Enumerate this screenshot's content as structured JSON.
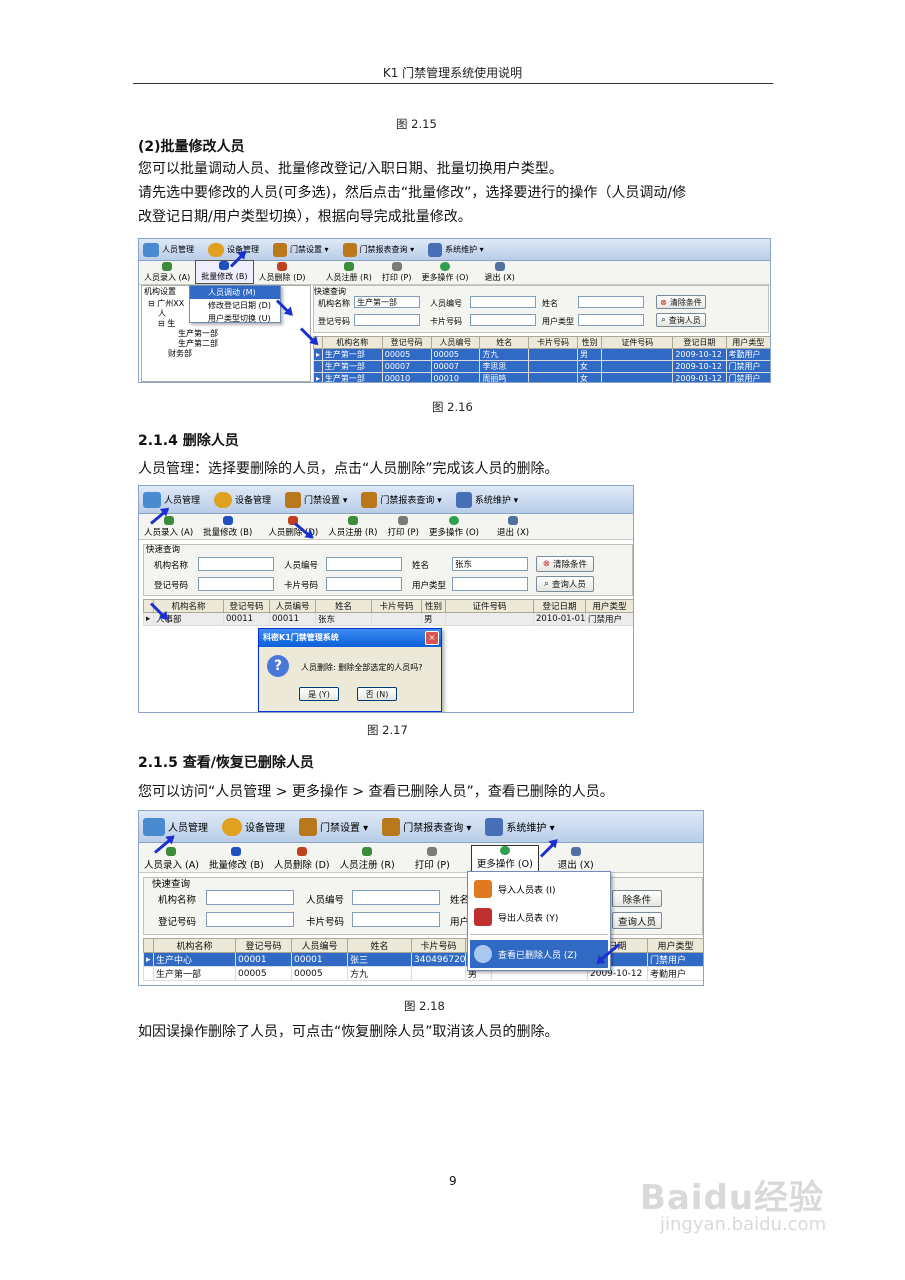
{
  "header": {
    "title": "K1 门禁管理系统使用说明"
  },
  "fig215": {
    "caption": "图 2.15"
  },
  "sec_batch": {
    "title": "(2)批量修改人员",
    "p1": "您可以批量调动人员、批量修改登记/入职日期、批量切换用户类型。",
    "p2a": "请先选中要修改的人员(可多选)，然后点击“批量修改”，选择要进行的操作（人员调动/修",
    "p2b": "改登记日期/用户类型切换），根据向导完成批量修改。"
  },
  "menu": {
    "people": "人员管理",
    "device": "设备管理",
    "door": "门禁设置 ▾",
    "report": "门禁报表查询 ▾",
    "system": "系统维护 ▾"
  },
  "toolbar": {
    "add": "人员录入 (A)",
    "batch": "批量修改 (B)",
    "delete": "人员删除 (D)",
    "cancel": "人员注册 (R)",
    "print": "打印 (P)",
    "more": "更多操作 (O)",
    "exit": "退出 (X)"
  },
  "quick": {
    "legend": "快速查询",
    "org": "机构名称",
    "empno": "人员编号",
    "name": "姓名",
    "regno": "登记号码",
    "cardno": "卡片号码",
    "usertype": "用户类型",
    "clear": "清除条件",
    "query": "查询人员"
  },
  "grid_headers": [
    "机构名称",
    "登记号码",
    "人员编号",
    "姓名",
    "卡片号码",
    "性别",
    "证件号码",
    "登记日期",
    "用户类型"
  ],
  "fig216": {
    "org_label": "机构设置",
    "org_value": "生产第一部",
    "tree": [
      "广州XX",
      "人",
      "生",
      "生产第一部",
      "生产第二部",
      "财务部"
    ],
    "menu_items": [
      "人员调动 (M)",
      "修改登记日期 (D)",
      "用户类型切换 (U)"
    ],
    "rows": [
      [
        "生产第一部",
        "00005",
        "00005",
        "方九",
        "",
        "男",
        "",
        "2009-10-12",
        "考勤用户"
      ],
      [
        "生产第一部",
        "00007",
        "00007",
        "李思思",
        "",
        "女",
        "",
        "2009-10-12",
        "门禁用户"
      ],
      [
        "生产第一部",
        "00010",
        "00010",
        "周丽鸣",
        "",
        "女",
        "",
        "2009-01-12",
        "门禁用户"
      ]
    ],
    "caption": "图 2.16"
  },
  "sec_delete": {
    "title": "2.1.4 删除人员",
    "p1": "人员管理：选择要删除的人员，点击“人员删除”完成该人员的删除。"
  },
  "fig217": {
    "name_value": "张东",
    "row": [
      "人事部",
      "00011",
      "00011",
      "张东",
      "",
      "男",
      "",
      "2010-01-01",
      "门禁用户"
    ],
    "dialog_title": "科密K1门禁管理系统",
    "dialog_msg": "人员删除: 删除全部选定的人员吗?",
    "yes": "是 (Y)",
    "no": "否 (N)",
    "caption": "图 2.17"
  },
  "sec_restore": {
    "title": "2.1.5 查看/恢复已删除人员",
    "p1": "您可以访问“人员管理 > 更多操作 > 查看已删除人员”，查看已删除的人员。",
    "p2": "如因误操作删除了人员，可点击“恢复删除人员”取消该人员的删除。"
  },
  "fig218": {
    "menu_items": [
      "导入人员表 (I)",
      "导出人员表 (Y)",
      "查看已删除人员 (Z)"
    ],
    "clear_partial": "除条件",
    "query_partial": "查询人员",
    "name_partial": "姓名",
    "usertype_partial": "用户",
    "header_partial": [
      "机构名称",
      "登记号码",
      "人员编号",
      "姓名",
      "卡片号码",
      "",
      "",
      "日期",
      "用户类型"
    ],
    "rows": [
      [
        "生产中心",
        "00001",
        "00001",
        "张三",
        "3404967200",
        "",
        "",
        "1-01",
        "门禁用户"
      ],
      [
        "生产第一部",
        "00005",
        "00005",
        "方九",
        "",
        "男",
        "",
        "2009-10-12",
        "考勤用户"
      ]
    ],
    "caption": "图 2.18"
  },
  "page_number": "9",
  "watermark": {
    "logo": "Baidu经验",
    "url": "jingyan.baidu.com"
  }
}
